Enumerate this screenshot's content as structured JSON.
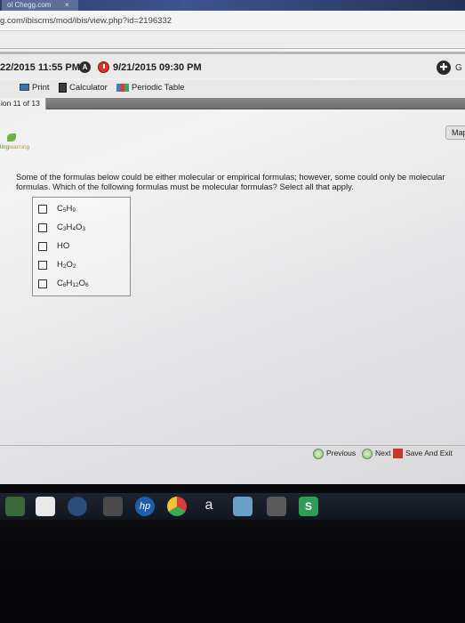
{
  "browser": {
    "tab_fragment": "ol Chegg.com",
    "url": "g.com/ibiscms/mod/ibis/view.php?id=2196332"
  },
  "timer": {
    "start_time": "22/2015 11:55 PM",
    "badge": "A",
    "due_time": "9/21/2015 09:30 PM",
    "right_cut": "G"
  },
  "tools": {
    "print": "Print",
    "calculator": "Calculator",
    "periodic_table": "Periodic Table"
  },
  "question_tab": "ion 11 of 13",
  "map_label": "Map",
  "logo": {
    "part1": "ling",
    "part2": "learning"
  },
  "question": {
    "text": "Some of the formulas below could be either molecular or empirical formulas; however, some could only be molecular formulas. Which of the following formulas must be molecular formulas? Select all that apply.",
    "options": [
      {
        "label": "C5H9"
      },
      {
        "label": "C3H4O3"
      },
      {
        "label": "HO"
      },
      {
        "label": "H2O2"
      },
      {
        "label": "C6H12O6"
      }
    ]
  },
  "footer": {
    "previous": "Previous",
    "next": "Next",
    "save_exit": "Save And Exit"
  },
  "taskbar": {
    "hp_label": "hp",
    "a_label": "a",
    "s_label": "S"
  },
  "colors": {
    "accent_green": "#6cb249",
    "question_bar": "#7a7a7a",
    "clock_red": "#d8332a"
  }
}
